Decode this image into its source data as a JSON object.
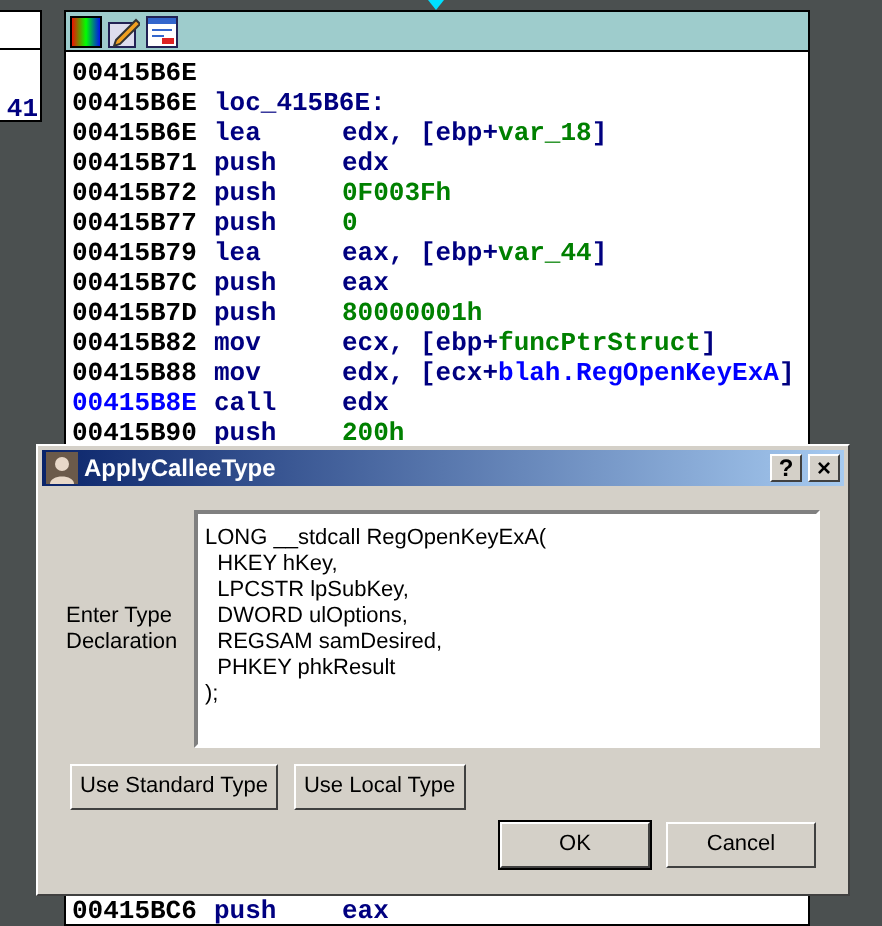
{
  "side_node": {
    "text": "41"
  },
  "code_view": {
    "lines": [
      {
        "address": "00415B6E",
        "highlighted": false
      },
      {
        "address": "00415B6E",
        "highlighted": false,
        "mnemonic": "loc_415B6E:"
      },
      {
        "address": "00415B6E",
        "highlighted": false,
        "mnemonic": "lea",
        "operands": [
          {
            "text": "edx, [ebp+",
            "kind": "reg"
          },
          {
            "text": "var_18",
            "kind": "name"
          },
          {
            "text": "]",
            "kind": "reg"
          }
        ]
      },
      {
        "address": "00415B71",
        "highlighted": false,
        "mnemonic": "push",
        "operands": [
          {
            "text": "edx",
            "kind": "reg"
          }
        ]
      },
      {
        "address": "00415B72",
        "highlighted": false,
        "mnemonic": "push",
        "operands": [
          {
            "text": "0F003Fh",
            "kind": "name"
          }
        ]
      },
      {
        "address": "00415B77",
        "highlighted": false,
        "mnemonic": "push",
        "operands": [
          {
            "text": "0",
            "kind": "name"
          }
        ]
      },
      {
        "address": "00415B79",
        "highlighted": false,
        "mnemonic": "lea",
        "operands": [
          {
            "text": "eax, [ebp+",
            "kind": "reg"
          },
          {
            "text": "var_44",
            "kind": "name"
          },
          {
            "text": "]",
            "kind": "reg"
          }
        ]
      },
      {
        "address": "00415B7C",
        "highlighted": false,
        "mnemonic": "push",
        "operands": [
          {
            "text": "eax",
            "kind": "reg"
          }
        ]
      },
      {
        "address": "00415B7D",
        "highlighted": false,
        "mnemonic": "push",
        "operands": [
          {
            "text": "80000001h",
            "kind": "name"
          }
        ]
      },
      {
        "address": "00415B82",
        "highlighted": false,
        "mnemonic": "mov",
        "operands": [
          {
            "text": "ecx, [ebp+",
            "kind": "reg"
          },
          {
            "text": "funcPtrStruct",
            "kind": "name"
          },
          {
            "text": "]",
            "kind": "reg"
          }
        ]
      },
      {
        "address": "00415B88",
        "highlighted": false,
        "mnemonic": "mov",
        "operands": [
          {
            "text": "edx, [ecx+",
            "kind": "reg"
          },
          {
            "text": "blah.RegOpenKeyExA",
            "kind": "member"
          },
          {
            "text": "]",
            "kind": "reg"
          }
        ]
      },
      {
        "address": "00415B8E",
        "highlighted": true,
        "mnemonic": "call",
        "operands": [
          {
            "text": "edx",
            "kind": "reg"
          }
        ]
      },
      {
        "address": "00415B90",
        "highlighted": false,
        "mnemonic": "push",
        "operands": [
          {
            "text": "200h",
            "kind": "name"
          }
        ]
      }
    ],
    "lines_below_dialog": [
      {
        "address": "00415BC6",
        "highlighted": false,
        "mnemonic": "push",
        "operands": [
          {
            "text": "eax",
            "kind": "reg"
          }
        ]
      }
    ]
  },
  "dialog": {
    "title": "ApplyCalleeType",
    "field_label": "Enter Type Declaration",
    "declaration": "LONG __stdcall RegOpenKeyExA(\n  HKEY hKey,\n  LPCSTR lpSubKey,\n  DWORD ulOptions,\n  REGSAM samDesired,\n  PHKEY phkResult\n);",
    "help_button": "?",
    "close_button": "×",
    "buttons": [
      {
        "label": "Use Standard Type",
        "default": false
      },
      {
        "label": "Use Local Type",
        "default": false
      }
    ],
    "footer_buttons": [
      {
        "label": "OK",
        "default": true
      },
      {
        "label": "Cancel",
        "default": false
      }
    ]
  }
}
